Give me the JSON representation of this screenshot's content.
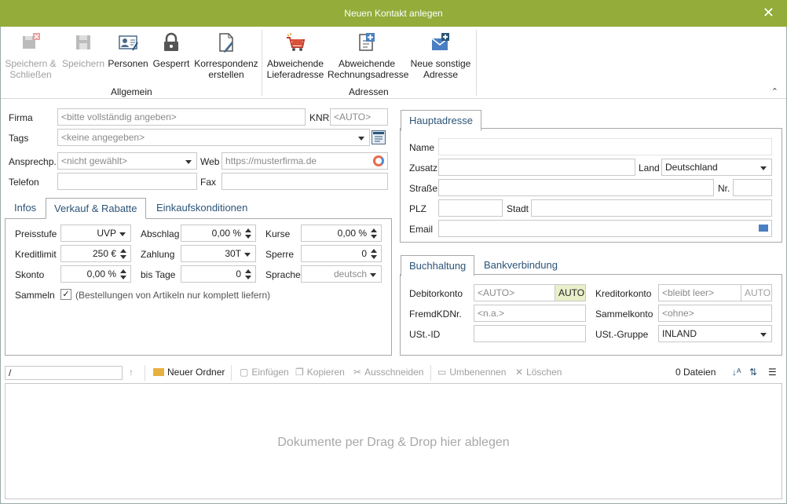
{
  "window": {
    "title": "Neuen Kontakt anlegen"
  },
  "ribbon": {
    "save_close": [
      "Speichern &",
      "Schließen"
    ],
    "save": "Speichern",
    "persons": "Personen",
    "locked": "Gesperrt",
    "correspondence": [
      "Korrespondenz",
      "erstellen"
    ],
    "group_general": "Allgemein",
    "alt_delivery": [
      "Abweichende",
      "Lieferadresse"
    ],
    "alt_billing": [
      "Abweichende",
      "Rechnungsadresse"
    ],
    "other_address": [
      "Neue sonstige",
      "Adresse"
    ],
    "group_addresses": "Adressen"
  },
  "form": {
    "firma_label": "Firma",
    "firma_placeholder": "<bitte vollständig angeben>",
    "knr_label": "KNR",
    "knr_value": "<AUTO>",
    "tags_label": "Tags",
    "tags_value": "<keine angegeben>",
    "ansprech_label": "Ansprechp.",
    "ansprech_value": "<nicht gewählt>",
    "web_label": "Web",
    "web_placeholder": "https://musterfirma.de",
    "telefon_label": "Telefon",
    "telefon_value": "",
    "fax_label": "Fax",
    "fax_value": ""
  },
  "tabs_left": [
    "Infos",
    "Verkauf & Rabatte",
    "Einkaufskonditionen"
  ],
  "sales": {
    "preisstufe_label": "Preisstufe",
    "preisstufe_value": "UVP",
    "abschlag_label": "Abschlag",
    "abschlag_value": "0,00 %",
    "kurse_label": "Kurse",
    "kurse_value": "0,00 %",
    "kreditlimit_label": "Kreditlimit",
    "kreditlimit_value": "250 €",
    "zahlung_label": "Zahlung",
    "zahlung_value": "30T",
    "sperre_label": "Sperre",
    "sperre_value": "0",
    "skonto_label": "Skonto",
    "skonto_value": "0,00 %",
    "bistage_label": "bis Tage",
    "bistage_value": "0",
    "sprache_label": "Sprache",
    "sprache_value": "deutsch",
    "sammeln_label": "Sammeln",
    "sammeln_checked": true,
    "sammeln_text": "(Bestellungen von Artikeln nur komplett liefern)"
  },
  "address": {
    "tab": "Hauptadresse",
    "name_label": "Name",
    "name_value": "",
    "zusatz_label": "Zusatz",
    "zusatz_value": "",
    "land_label": "Land",
    "land_value": "Deutschland",
    "strasse_label": "Straße",
    "strasse_value": "",
    "nr_label": "Nr.",
    "nr_value": "",
    "plz_label": "PLZ",
    "plz_value": "",
    "stadt_label": "Stadt",
    "stadt_value": "",
    "email_label": "Email",
    "email_value": ""
  },
  "accounting": {
    "tabs": [
      "Buchhaltung",
      "Bankverbindung"
    ],
    "debitor_label": "Debitorkonto",
    "debitor_value": "<AUTO>",
    "debitor_btn": "AUTO",
    "kreditor_label": "Kreditorkonto",
    "kreditor_value": "<bleibt leer>",
    "kreditor_btn": "AUTO",
    "fremd_label": "FremdKDNr.",
    "fremd_value": "<n.a.>",
    "sammel_label": "Sammelkonto",
    "sammel_value": "<ohne>",
    "ust_label": "USt.-ID",
    "ust_value": "",
    "ustgruppe_label": "USt.-Gruppe",
    "ustgruppe_value": "INLAND"
  },
  "files": {
    "path": "/",
    "new_folder": "Neuer Ordner",
    "paste": "Einfügen",
    "copy": "Kopieren",
    "cut": "Ausschneiden",
    "rename": "Umbenennen",
    "delete": "Löschen",
    "count": "0 Dateien",
    "drop_hint": "Dokumente per Drag & Drop hier ablegen"
  },
  "colors": {
    "titlebar": "#93ac3a",
    "tab_text": "#2b5478"
  }
}
